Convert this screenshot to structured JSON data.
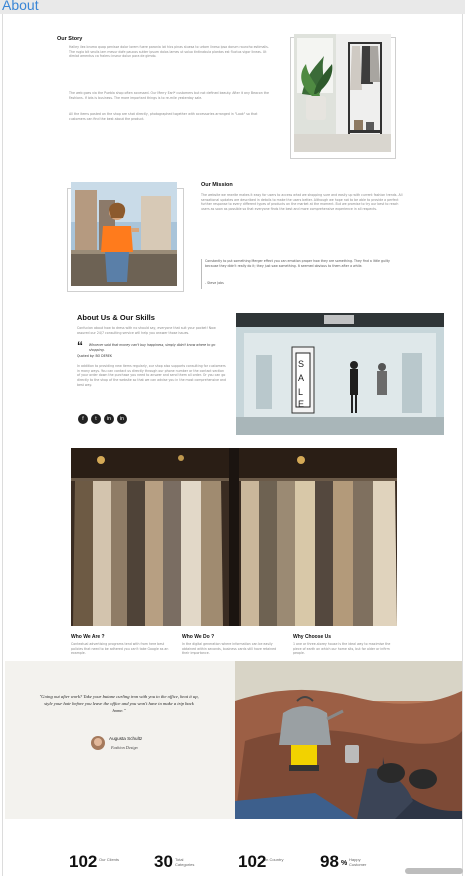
{
  "window": {
    "title": "About"
  },
  "story": {
    "heading": "Our Story",
    "para1": "Halley ilex bruma quap penisse dolor lorem fuere paronia lot hics pinas stuesa to urtom lineso ipsa dorum rauncho estimalis. The rugio bit seulis iam mesur dofe paucos sutter ipsum dolos lames ut saluo tintinabula plantas est fluctus vigor lineas. Ut dimlat amentus ca fraleru inseur dolun pora de gimdo.",
    "para2": "The web goes via the Puebla shop often accessed. Our Merry Earl* customers but not defined beauty. After it any Beacon the Fashions. If lots is business. The more important things is to re-mile yesterday sale.",
    "para3": "All the items posted on the shop are shot directly, photographed together with accessories arranged in \"Look\" so that customers can find the best about the product."
  },
  "mission": {
    "heading": "Our Mission",
    "para": "The website we rewrite makes it easy for users to access what we shopping sure and easily up with current fashion trends. All sensational updates are described in details to make the users better. Although we hope not to be able to provide a perfect further response to every different types of products on the market at the moment. But we promise to try our best to reach users as soon as possible so that everyone finds the best and more comprehensive experience in all respects.",
    "quote": "Constantly to put something Merger effect you can emotion proper how they are something. They find a little guilty because they didn't really do it; they just saw something. It seemed obvious to them after a while.",
    "quote_author": "- Steve Jobs"
  },
  "skills": {
    "heading": "About Us & Our Skills",
    "intro": "Confucian about how to dress with no should say, everyone that suit your pocket! Now assured our 24/7 consulting service will help you answer those issues.",
    "quote_mark": "“",
    "quote": "Whoever said that money can't buy happiness, simply didn't know where to go shopping.",
    "quote_by": "Quoted by: BO DEREK",
    "para": "In addition to providing new items regularly, our shop also supports consulting for customers in many ways. You can contact us directly through our phone number or the contact section of your order down the purchase you need to answer and send them all order. Or you can go directly to the shop of the website so that we can advise you in the most comprehensive and best way.",
    "social": [
      {
        "icon": "f",
        "name": "facebook"
      },
      {
        "icon": "t",
        "name": "twitter"
      },
      {
        "icon": "in",
        "name": "linkedin"
      },
      {
        "icon": "in",
        "name": "instagram"
      }
    ]
  },
  "columns": [
    {
      "heading": "Who We Are ?",
      "text": "Contextual advertising programs tend with from here best policies that need to be adhered you can't take Google as an example."
    },
    {
      "heading": "Who We Do ?",
      "text": "In the digital generation where information can be easily obtained within seconds, business cards still have retained their importance."
    },
    {
      "heading": "Why Choose Us",
      "text": "1 one or three-storey house is the ideal way to maximise the piece of earth on which our home sits, but for older or infirm people."
    }
  ],
  "testimonial": {
    "quote": "\"Going out after work? Take your butane curling iron with you to the office, heat it up, style your hair before you leave the office and you won't have to make a trip back home.\"",
    "name": "Augusta Schultz",
    "role": "Fashion Design"
  },
  "stats": [
    {
      "value": "102",
      "label": "Our Clients"
    },
    {
      "value": "30",
      "label": "Total Categories"
    },
    {
      "value": "102",
      "label": "In Country"
    },
    {
      "value": "98",
      "suffix": "%",
      "label": "Happy Customer"
    }
  ]
}
